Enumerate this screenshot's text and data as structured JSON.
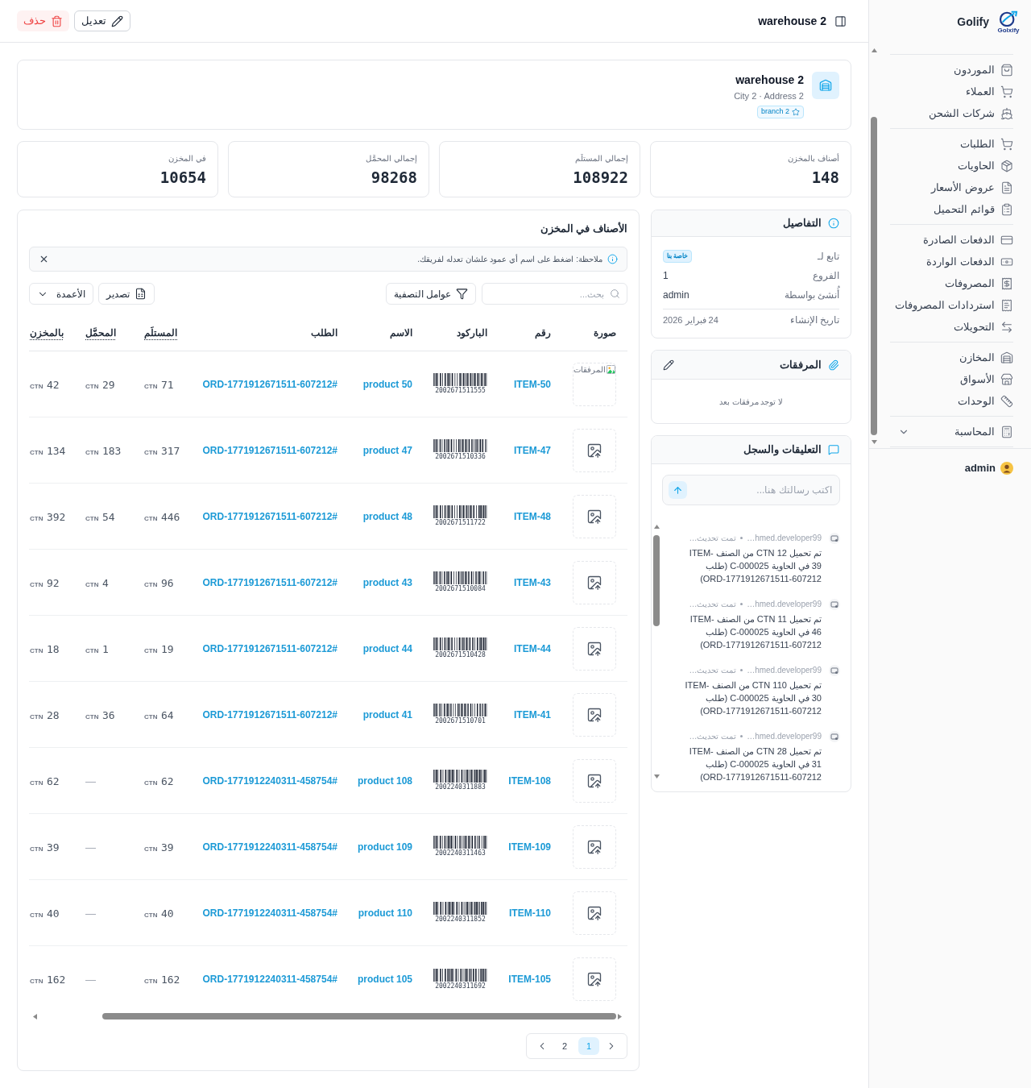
{
  "sidebar": {
    "brand": {
      "name": "Golify",
      "logo_caption": "Golxify"
    },
    "groups": [
      {
        "items": [
          {
            "label": "الموردون",
            "kind": "link"
          },
          {
            "label": "العملاء",
            "kind": "link"
          },
          {
            "label": "شركات الشحن",
            "kind": "link"
          }
        ]
      },
      {
        "items": [
          {
            "label": "الطلبات",
            "kind": "link"
          },
          {
            "label": "الحاويات",
            "kind": "link"
          },
          {
            "label": "عروض الأسعار",
            "kind": "link"
          },
          {
            "label": "قوائم التحميل",
            "kind": "link"
          }
        ]
      },
      {
        "items": [
          {
            "label": "الدفعات الصادرة",
            "kind": "link"
          },
          {
            "label": "الدفعات الواردة",
            "kind": "link"
          },
          {
            "label": "المصروفات",
            "kind": "link"
          },
          {
            "label": "استردادات المصروفات",
            "kind": "link"
          },
          {
            "label": "التحويلات",
            "kind": "link"
          }
        ]
      },
      {
        "items": [
          {
            "label": "المخازن",
            "kind": "link"
          },
          {
            "label": "الأسواق",
            "kind": "link"
          },
          {
            "label": "الوحدات",
            "kind": "link"
          }
        ]
      },
      {
        "items": [
          {
            "label": "المحاسبة",
            "kind": "group",
            "expanded": false
          }
        ]
      }
    ],
    "user": {
      "name": "admin"
    }
  },
  "header": {
    "title": "warehouse 2",
    "actions": [
      {
        "label": "تعديل",
        "kind": "edit"
      },
      {
        "label": "حذف",
        "kind": "delete"
      }
    ]
  },
  "warehouse": {
    "name": "warehouse 2",
    "address": "City 2 · Address 2",
    "branch": "branch 2"
  },
  "stats": [
    {
      "label": "أصناف بالمخزن",
      "value": "148"
    },
    {
      "label": "إجمالي المستلَم",
      "value": "108922"
    },
    {
      "label": "إجمالي المحمَّل",
      "value": "98268"
    },
    {
      "label": "في المخزن",
      "value": "10654"
    }
  ],
  "details": {
    "title": "التفاصيل",
    "fields": [
      {
        "label": "تابع لـ",
        "value": "خاصة بنا",
        "kind": "badge"
      },
      {
        "label": "الفروع",
        "value": "1",
        "kind": "text"
      },
      {
        "label": "أُنشئ بواسطة",
        "value": "admin",
        "kind": "text"
      },
      {
        "label": "تاريخ الإنشاء",
        "value": "24 فبراير 2026",
        "kind": "meta"
      }
    ]
  },
  "attachments": {
    "title": "المرفقات",
    "empty_text": "لا توجد مرفقات بعد"
  },
  "comments": {
    "title": "التعليقات والسجل",
    "input": {
      "placeholder": "اكتب رسالتك هنا..."
    },
    "entries": [
      {
        "author": "…hmed.developer99",
        "action": "تمت تحديث…",
        "text": "تم تحميل 12 CTN من الصنف ITEM-39 في الحاوية C-000025 (طلب ORD-1771912671511-607212)"
      },
      {
        "author": "…hmed.developer99",
        "action": "تمت تحديث…",
        "text": "تم تحميل 11 CTN من الصنف ITEM-46 في الحاوية C-000025 (طلب ORD-1771912671511-607212)"
      },
      {
        "author": "…hmed.developer99",
        "action": "تمت تحديث…",
        "text": "تم تحميل 110 CTN من الصنف ITEM-30 في الحاوية C-000025 (طلب ORD-1771912671511-607212)"
      },
      {
        "author": "…hmed.developer99",
        "action": "تمت تحديث…",
        "text": "تم تحميل 28 CTN من الصنف ITEM-31 في الحاوية C-000025 (طلب ORD-1771912671511-607212)"
      }
    ]
  },
  "items_table": {
    "title": "الأصناف في المخزن",
    "note": "ملاحظة: اضغط على اسم أي عمود علشان تعدله لفريقك.",
    "search": {
      "placeholder": "بحث..."
    },
    "filter_button": "عوامل التصفية",
    "export_button": "تصدير",
    "columns_button": "الأعمدة",
    "columns": [
      {
        "label": "صورة",
        "kind": "text"
      },
      {
        "label": "رقم",
        "kind": "text"
      },
      {
        "label": "الباركود",
        "kind": "text"
      },
      {
        "label": "الاسم",
        "kind": "text"
      },
      {
        "label": "الطلب",
        "kind": "text"
      },
      {
        "label": "المستلَم",
        "kind": "quantity"
      },
      {
        "label": "المحمَّل",
        "kind": "quantity"
      },
      {
        "label": "بالمخزن",
        "kind": "quantity"
      }
    ],
    "rows": [
      {
        "image": {
          "kind": "broken",
          "alt": "المرفقات"
        },
        "number": "ITEM-50",
        "barcode": "2002671511555",
        "name": "product 50",
        "order": "ORD-1771912671511-607212#",
        "received": {
          "unit": "CTN",
          "value": "71"
        },
        "loaded": {
          "unit": "CTN",
          "value": "29"
        },
        "in_stock": {
          "unit": "CTN",
          "value": "42"
        }
      },
      {
        "image": {
          "kind": "placeholder"
        },
        "number": "ITEM-47",
        "barcode": "2002671510336",
        "name": "product 47",
        "order": "ORD-1771912671511-607212#",
        "received": {
          "unit": "CTN",
          "value": "317"
        },
        "loaded": {
          "unit": "CTN",
          "value": "183"
        },
        "in_stock": {
          "unit": "CTN",
          "value": "134"
        }
      },
      {
        "image": {
          "kind": "placeholder"
        },
        "number": "ITEM-48",
        "barcode": "2002671511722",
        "name": "product 48",
        "order": "ORD-1771912671511-607212#",
        "received": {
          "unit": "CTN",
          "value": "446"
        },
        "loaded": {
          "unit": "CTN",
          "value": "54"
        },
        "in_stock": {
          "unit": "CTN",
          "value": "392"
        }
      },
      {
        "image": {
          "kind": "placeholder"
        },
        "number": "ITEM-43",
        "barcode": "2002671510084",
        "name": "product 43",
        "order": "ORD-1771912671511-607212#",
        "received": {
          "unit": "CTN",
          "value": "96"
        },
        "loaded": {
          "unit": "CTN",
          "value": "4"
        },
        "in_stock": {
          "unit": "CTN",
          "value": "92"
        }
      },
      {
        "image": {
          "kind": "placeholder"
        },
        "number": "ITEM-44",
        "barcode": "2002671510428",
        "name": "product 44",
        "order": "ORD-1771912671511-607212#",
        "received": {
          "unit": "CTN",
          "value": "19"
        },
        "loaded": {
          "unit": "CTN",
          "value": "1"
        },
        "in_stock": {
          "unit": "CTN",
          "value": "18"
        }
      },
      {
        "image": {
          "kind": "placeholder"
        },
        "number": "ITEM-41",
        "barcode": "2002671510701",
        "name": "product 41",
        "order": "ORD-1771912671511-607212#",
        "received": {
          "unit": "CTN",
          "value": "64"
        },
        "loaded": {
          "unit": "CTN",
          "value": "36"
        },
        "in_stock": {
          "unit": "CTN",
          "value": "28"
        }
      },
      {
        "image": {
          "kind": "placeholder"
        },
        "number": "ITEM-108",
        "barcode": "2002240311883",
        "name": "product 108",
        "order": "ORD-1771912240311-458754#",
        "received": {
          "unit": "CTN",
          "value": "62"
        },
        "loaded": {
          "value": "—"
        },
        "in_stock": {
          "unit": "CTN",
          "value": "62"
        }
      },
      {
        "image": {
          "kind": "placeholder"
        },
        "number": "ITEM-109",
        "barcode": "2002240311463",
        "name": "product 109",
        "order": "ORD-1771912240311-458754#",
        "received": {
          "unit": "CTN",
          "value": "39"
        },
        "loaded": {
          "value": "—"
        },
        "in_stock": {
          "unit": "CTN",
          "value": "39"
        }
      },
      {
        "image": {
          "kind": "placeholder"
        },
        "number": "ITEM-110",
        "barcode": "2002240311852",
        "name": "product 110",
        "order": "ORD-1771912240311-458754#",
        "received": {
          "unit": "CTN",
          "value": "40"
        },
        "loaded": {
          "value": "—"
        },
        "in_stock": {
          "unit": "CTN",
          "value": "40"
        }
      },
      {
        "image": {
          "kind": "placeholder"
        },
        "number": "ITEM-105",
        "barcode": "2002240311692",
        "name": "product 105",
        "order": "ORD-1771912240311-458754#",
        "received": {
          "unit": "CTN",
          "value": "162"
        },
        "loaded": {
          "value": "—"
        },
        "in_stock": {
          "unit": "CTN",
          "value": "162"
        }
      }
    ],
    "pagination": {
      "pages": [
        {
          "label": "1",
          "selected": true
        },
        {
          "label": "2",
          "selected": false
        }
      ]
    }
  }
}
